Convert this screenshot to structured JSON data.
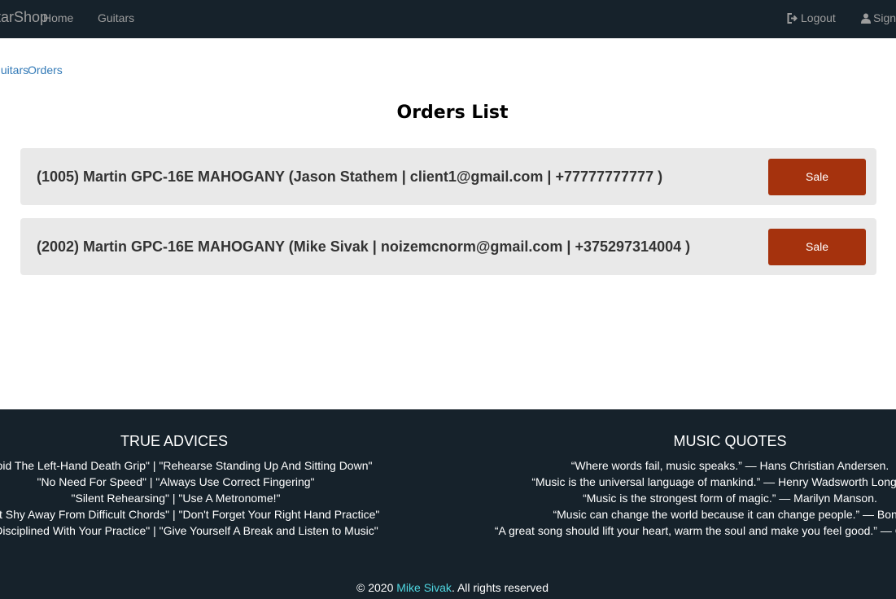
{
  "navbar": {
    "brand": "GuitarShop",
    "links": {
      "home": "Home",
      "guitars": "Guitars"
    },
    "logout": "Logout",
    "signup": "Sign Up"
  },
  "breadcrumb": {
    "previous": "Guitars",
    "current": "Orders"
  },
  "page_title": "Orders List",
  "orders": [
    {
      "text": "(1005) Martin GPC-16E MAHOGANY (Jason Stathem | client1@gmail.com | +77777777777 )",
      "button": "Sale"
    },
    {
      "text": "(2002) Martin GPC-16E MAHOGANY (Mike Sivak | noizemcnorm@gmail.com | +375297314004 )",
      "button": "Sale"
    }
  ],
  "footer": {
    "advices": {
      "heading": "TRUE ADVICES",
      "lines": [
        "\"Avoid The Left-Hand Death Grip\" | \"Rehearse Standing Up And Sitting Down\"",
        "\"No Need For Speed\" | \"Always Use Correct Fingering\"",
        "\"Silent Rehearsing\" | \"Use A Metronome!\"",
        "\"Don't Shy Away From Difficult Chords\" | \"Don't Forget Your Right Hand Practice\"",
        "\"Be Disciplined With Your Practice\" | \"Give Yourself A Break and Listen to Music\""
      ]
    },
    "quotes": {
      "heading": "MUSIC QUOTES",
      "lines": [
        "“Where words fail, music speaks.” — Hans Christian Andersen.",
        "“Music is the universal language of mankind.” — Henry Wadsworth Longfellow.",
        "“Music is the strongest form of magic.” — Marilyn Manson.",
        "“Music can change the world because it can change people.” — Bono.",
        "“A great song should lift your heart, warm the soul and make you feel good.” — Colbie Caillat."
      ]
    },
    "copyright_prefix": "© 2020 ",
    "author": "Mike Sivak",
    "copyright_suffix": ". All rights reserved"
  },
  "colors": {
    "navbar_bg": "#16222b",
    "sale_button": "#a5320d",
    "card_bg": "#e9e9e9",
    "link": "#337ab7",
    "author_link": "#4fd6e0"
  }
}
